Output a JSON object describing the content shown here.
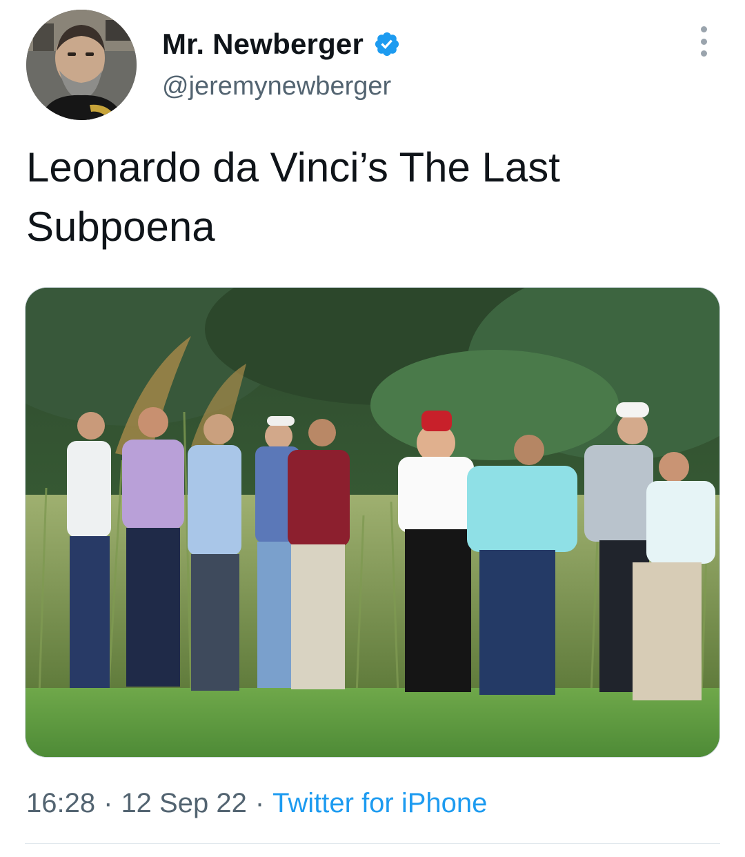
{
  "author": {
    "display_name": "Mr. Newberger",
    "handle": "@jeremynewberger",
    "verified": true,
    "avatar_icon": "profile-photo"
  },
  "tweet": {
    "text": "Leonardo da Vinci’s The Last Subpoena",
    "media_icon": "photo-golf-course-group"
  },
  "meta": {
    "time": "16:28",
    "date": "12 Sep 22",
    "separator": "·",
    "source": "Twitter for iPhone"
  },
  "colors": {
    "verified_badge": "#1d9bf0",
    "source_link": "#1d9bf0",
    "secondary_text": "#536471",
    "primary_text": "#0f1419",
    "divider": "#e1e8ed"
  },
  "icons": {
    "more": "more-options-icon",
    "verified": "verified-badge-icon"
  }
}
